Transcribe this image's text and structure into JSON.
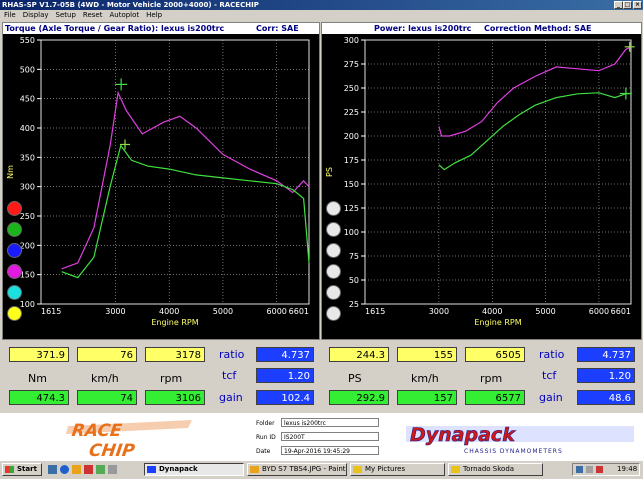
{
  "window": {
    "title": "RHAS-SP V1.7-05B   (4WD - Motor Vehicle 2000+4000)  - RACECHIP",
    "minimize_glyph": "_",
    "maximize_glyph": "□",
    "close_glyph": "×"
  },
  "menu": {
    "items": [
      "File",
      "Display",
      "Setup",
      "Reset",
      "Autoplot",
      "Help"
    ]
  },
  "torque_panel": {
    "title_left": "Torque (Axle Torque / Gear Ratio): lexus is200trc",
    "title_right": "Corr: SAE",
    "ylabel": "Nm",
    "xlabel": "Engine RPM",
    "y_ticks": [
      "550",
      "500",
      "450",
      "400",
      "350",
      "300",
      "250",
      "200",
      "150",
      "100"
    ],
    "x_ticks": [
      "1615",
      "3000",
      "4000",
      "5000",
      "6000",
      "6601"
    ]
  },
  "power_panel": {
    "title_left": "Power: lexus is200trc",
    "title_right": "Correction Method: SAE",
    "ylabel": "PS",
    "xlabel": "Engine RPM",
    "y_ticks": [
      "300",
      "275",
      "250",
      "225",
      "200",
      "175",
      "150",
      "125",
      "100",
      "75",
      "50",
      "25"
    ],
    "x_ticks": [
      "1615",
      "3000",
      "4000",
      "5000",
      "6000",
      "6601"
    ]
  },
  "colors": {
    "tuned_curve": "#e040e0",
    "stock_curve": "#40e040",
    "marker": "#90e040",
    "panel_bg": "#000000",
    "grid": "#e0e0e0",
    "accent_blue": "#1c3fff",
    "readout_yellow": "#ffff66",
    "readout_green": "#33ee33"
  },
  "chart_data": [
    {
      "type": "line",
      "x_unit": "Engine RPM",
      "y_unit": "Nm",
      "xlim": [
        1615,
        6601
      ],
      "ylim": [
        100,
        550
      ],
      "series": [
        {
          "x": [
            2000,
            2300,
            2600,
            2900,
            3050,
            3200,
            3500,
            3900,
            4200,
            4500,
            5000,
            5500,
            6000,
            6300,
            6500,
            6601
          ],
          "y": [
            160,
            170,
            230,
            370,
            460,
            430,
            390,
            410,
            420,
            400,
            355,
            330,
            310,
            290,
            310,
            300
          ]
        },
        {
          "x": [
            2000,
            2300,
            2600,
            2900,
            3100,
            3300,
            3600,
            4000,
            4500,
            5000,
            5500,
            6000,
            6300,
            6500,
            6601
          ],
          "y": [
            155,
            145,
            180,
            300,
            370,
            345,
            335,
            330,
            320,
            315,
            310,
            305,
            295,
            280,
            170
          ]
        }
      ],
      "markers": [
        {
          "x": 3106,
          "y": 474.3
        },
        {
          "x": 3178,
          "y": 371.9
        }
      ]
    },
    {
      "type": "line",
      "x_unit": "Engine RPM",
      "y_unit": "PS",
      "xlim": [
        1615,
        6601
      ],
      "ylim": [
        25,
        300
      ],
      "series": [
        {
          "x": [
            3000,
            3050,
            3200,
            3500,
            3800,
            4100,
            4400,
            4800,
            5200,
            5600,
            6000,
            6300,
            6500,
            6601
          ],
          "y": [
            210,
            200,
            200,
            205,
            215,
            235,
            250,
            262,
            272,
            270,
            268,
            275,
            290,
            292.9
          ]
        },
        {
          "x": [
            3000,
            3100,
            3300,
            3600,
            3900,
            4200,
            4500,
            4800,
            5200,
            5600,
            6000,
            6300,
            6500,
            6601
          ],
          "y": [
            170,
            165,
            172,
            180,
            195,
            210,
            222,
            232,
            240,
            244,
            245,
            240,
            244,
            244.3
          ]
        }
      ],
      "markers": [
        {
          "x": 6505,
          "y": 244.3
        },
        {
          "x": 6577,
          "y": 292.9
        }
      ]
    }
  ],
  "torque_readout": {
    "row1": [
      "371.9",
      "76",
      "3178"
    ],
    "units": [
      "Nm",
      "km/h",
      "rpm"
    ],
    "row2": [
      "474.3",
      "74",
      "3106"
    ],
    "side_labels": [
      "ratio",
      "tcf",
      "gain"
    ],
    "side_values": [
      "4.737",
      "1.20",
      "102.4"
    ]
  },
  "power_readout": {
    "row1": [
      "244.3",
      "155",
      "6505"
    ],
    "units": [
      "PS",
      "km/h",
      "rpm"
    ],
    "row2": [
      "292.9",
      "157",
      "6577"
    ],
    "side_labels": [
      "ratio",
      "tcf",
      "gain"
    ],
    "side_values": [
      "4.737",
      "1.20",
      "48.6"
    ]
  },
  "info": {
    "logo_left": "RACE CHIP",
    "logo_right": "Dynapack",
    "logo_right_sub": "CHASSIS DYNAMOMETERS",
    "folder_label": "Folder",
    "folder_value": "lexus is200trc",
    "run_label": "Run ID",
    "run_value": "IS200T",
    "date_label": "Date",
    "date_value": "19-Apr-2016  19:45:29"
  },
  "taskbar": {
    "start": "Start",
    "items": [
      "Dynapack",
      "BYD S7 TBS4.JPG - Paint",
      "My Pictures",
      "Tornado Skoda"
    ],
    "clock": "19:48"
  }
}
